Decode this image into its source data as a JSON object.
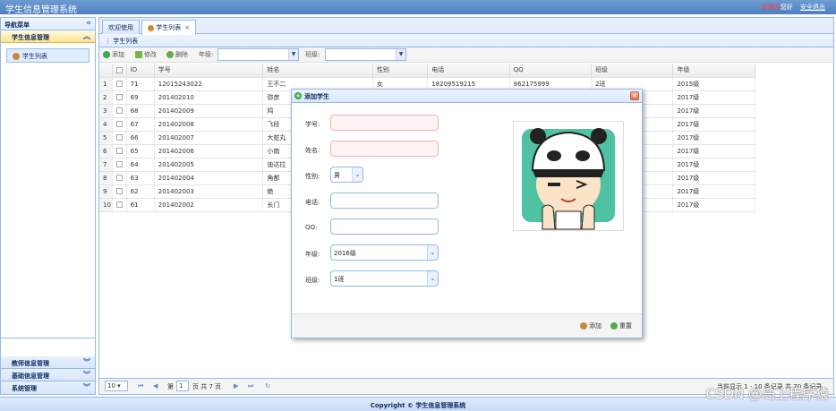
{
  "header": {
    "title": "学生信息管理系统",
    "admin_name": "管理员",
    "greeting": "您好",
    "logout": "安全退出"
  },
  "west": {
    "title": "导航菜单",
    "collapse_icon": "double-chevron-left-icon",
    "accordion": [
      {
        "label": "学生信息管理",
        "selected": true,
        "items": [
          "学生列表"
        ]
      },
      {
        "label": "教师信息管理",
        "selected": false
      },
      {
        "label": "基础信息管理",
        "selected": false
      },
      {
        "label": "系统管理",
        "selected": false
      }
    ]
  },
  "tabs": [
    {
      "label": "欢迎使用"
    },
    {
      "label": "学生列表",
      "close": "×"
    }
  ],
  "grid": {
    "title": "学生列表",
    "toolbar": {
      "add": "添加",
      "edit": "修改",
      "delete": "删除",
      "grade_label": "年级:",
      "class_label": "班级:"
    },
    "columns": [
      "ID",
      "学号",
      "姓名",
      "性别",
      "电话",
      "QQ",
      "班级",
      "年级"
    ],
    "rows": [
      [
        "1",
        "71",
        "12015243022",
        "王不二",
        "女",
        "18209519215",
        "962175999",
        "2班",
        "2015级"
      ],
      [
        "2",
        "69",
        "201402010",
        "弥彦",
        "",
        "",
        "",
        "",
        "2017级"
      ],
      [
        "3",
        "68",
        "201402009",
        "鸠",
        "",
        "",
        "",
        "",
        "2017级"
      ],
      [
        "4",
        "67",
        "201402008",
        "飞段",
        "",
        "",
        "",
        "",
        "2017级"
      ],
      [
        "5",
        "66",
        "201402007",
        "大蛇丸",
        "",
        "",
        "",
        "",
        "2017级"
      ],
      [
        "6",
        "65",
        "201402006",
        "小南",
        "",
        "",
        "",
        "",
        "2017级"
      ],
      [
        "7",
        "64",
        "201402005",
        "迪达拉",
        "",
        "",
        "",
        "",
        "2017级"
      ],
      [
        "8",
        "63",
        "201402004",
        "角都",
        "",
        "",
        "",
        "",
        "2017级"
      ],
      [
        "9",
        "62",
        "201402003",
        "绝",
        "",
        "",
        "",
        "",
        "2017级"
      ],
      [
        "10",
        "61",
        "201402002",
        "长门",
        "",
        "",
        "",
        "",
        "2017级"
      ]
    ],
    "pager": {
      "page_size": "10",
      "page_label": "第",
      "page": "1",
      "page_of": "页 共 7 页",
      "summary": "当前显示 1 - 10 条记录 共 70 条记录"
    }
  },
  "dialog": {
    "title": "添加学生",
    "fields": {
      "number": "学号:",
      "name": "姓名:",
      "gender": "性别:",
      "gender_value": "男",
      "phone": "电话:",
      "qq": "QQ:",
      "grade": "年级:",
      "grade_value": "2016级",
      "clazz": "班级:",
      "clazz_value": "1班"
    },
    "add_button": "添加",
    "reset_button": "重置"
  },
  "footer": "Copyright © 学生信息管理系统",
  "watermark": "CSDN @岛上程序猿"
}
